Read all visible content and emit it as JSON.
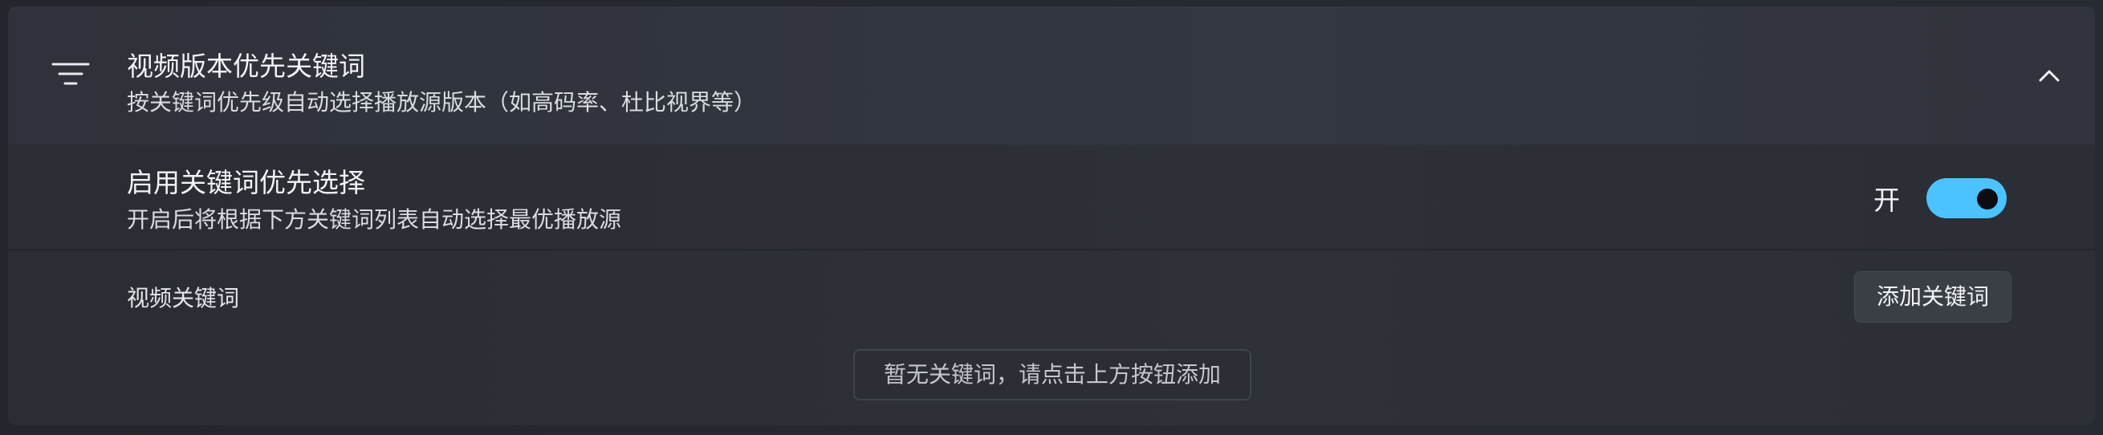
{
  "header": {
    "icon": "filter-icon",
    "title": "视频版本优先关键词",
    "subtitle": "按关键词优先级自动选择播放源版本（如高码率、杜比视界等）",
    "collapse_icon": "chevron-up-icon",
    "expanded": true
  },
  "keyword_priority": {
    "title": "启用关键词优先选择",
    "description": "开启后将根据下方关键词列表自动选择最优播放源",
    "state_label": "开",
    "enabled": true
  },
  "keywords": {
    "label": "视频关键词",
    "add_button_label": "添加关键词",
    "empty_hint": "暂无关键词，请点击上方按钮添加",
    "items": []
  },
  "colors": {
    "accent": "#4cc2ff",
    "background": "#2b2e34",
    "text_primary": "#f1f3f6",
    "text_secondary": "#d9dce1"
  }
}
